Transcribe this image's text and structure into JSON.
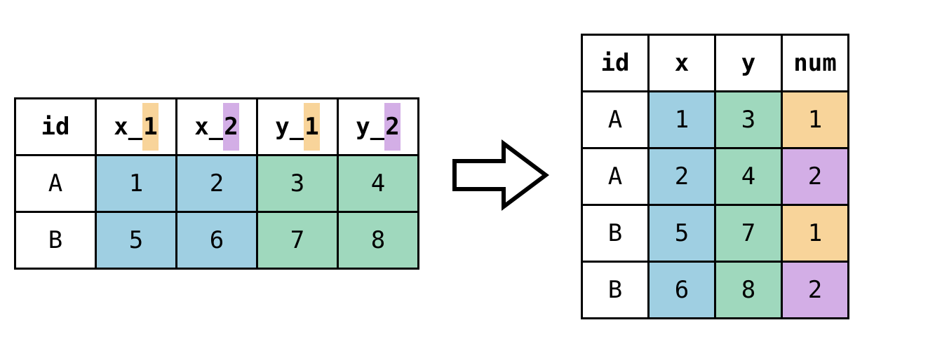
{
  "left": {
    "headers": {
      "id": "id",
      "x1": {
        "prefix": "x_",
        "suffix": "1",
        "suffix_color": "orange"
      },
      "x2": {
        "prefix": "x_",
        "suffix": "2",
        "suffix_color": "purple"
      },
      "y1": {
        "prefix": "y_",
        "suffix": "1",
        "suffix_color": "orange"
      },
      "y2": {
        "prefix": "y_",
        "suffix": "2",
        "suffix_color": "purple"
      }
    },
    "rows": [
      {
        "id": "A",
        "x1": "1",
        "x2": "2",
        "y1": "3",
        "y2": "4"
      },
      {
        "id": "B",
        "x1": "5",
        "x2": "6",
        "y1": "7",
        "y2": "8"
      }
    ]
  },
  "right": {
    "headers": {
      "id": "id",
      "x": "x",
      "y": "y",
      "num": "num"
    },
    "rows": [
      {
        "id": "A",
        "x": "1",
        "y": "3",
        "num": "1",
        "num_color": "orange"
      },
      {
        "id": "A",
        "x": "2",
        "y": "4",
        "num": "2",
        "num_color": "purple"
      },
      {
        "id": "B",
        "x": "5",
        "y": "7",
        "num": "1",
        "num_color": "orange"
      },
      {
        "id": "B",
        "x": "6",
        "y": "8",
        "num": "2",
        "num_color": "purple"
      }
    ]
  },
  "colors": {
    "x": "blue",
    "y": "green"
  }
}
